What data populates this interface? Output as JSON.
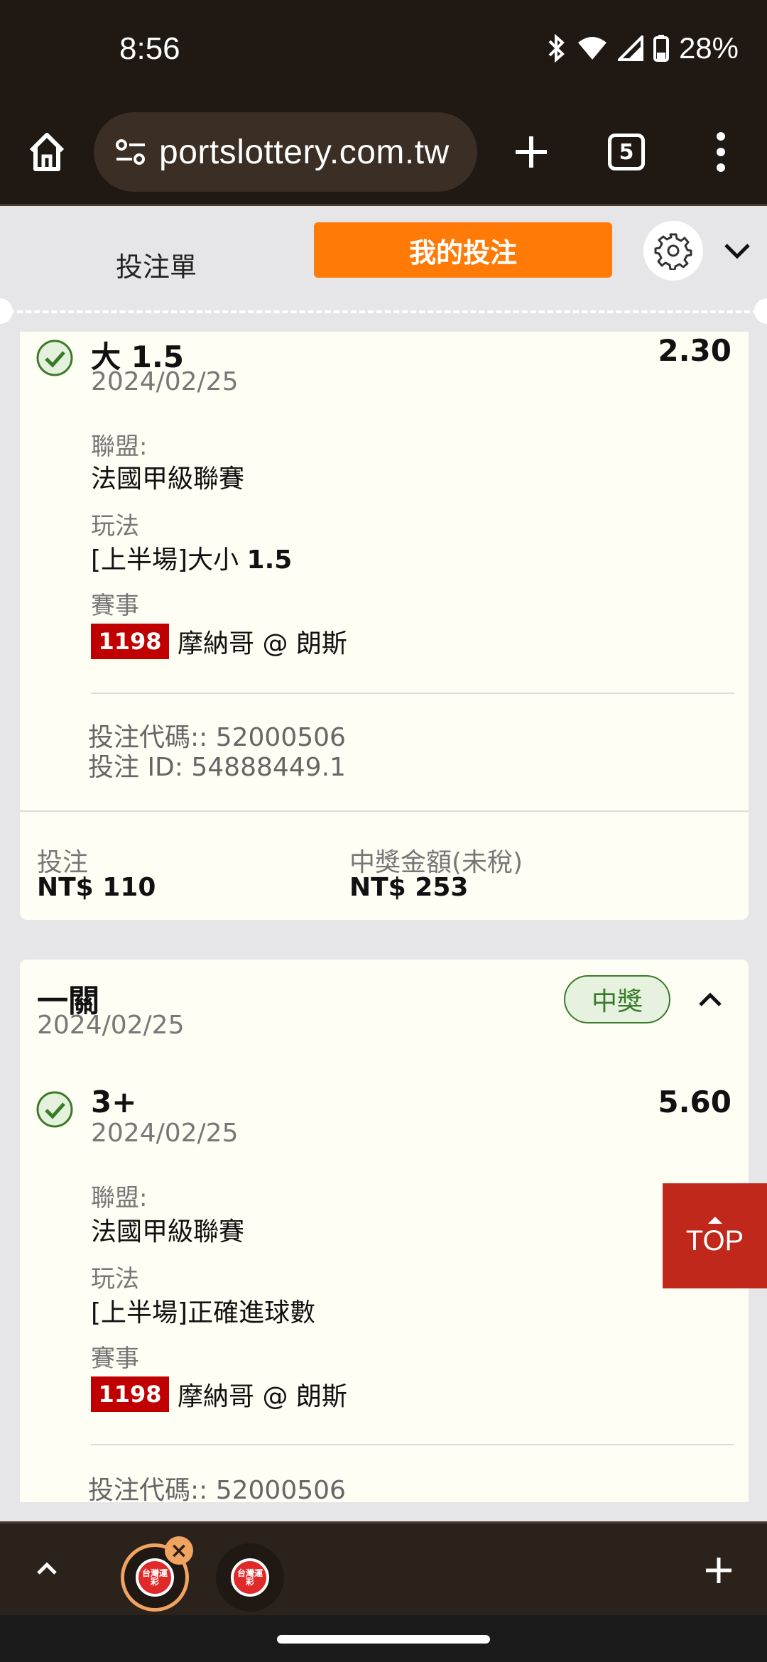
{
  "status_bar": {
    "time": "8:56",
    "battery": "28%",
    "icons": [
      "bluetooth-icon",
      "wifi-icon",
      "signal-icon",
      "battery-icon"
    ]
  },
  "browser": {
    "url": "portslottery.com.tw",
    "tab_count": "5"
  },
  "sheet": {
    "tab_betslip": "投注單",
    "tab_mybets": "我的投注",
    "accent": "#ff7a06"
  },
  "bet1": {
    "selection": "大 1.5",
    "odds": "2.30",
    "date": "2024/02/25",
    "league_label": "聯盟:",
    "league": "法國甲級聯賽",
    "market_label": "玩法",
    "market_prefix": "[上半場]大小 ",
    "market_line": "1.5",
    "event_label": "賽事",
    "event_no": "1198",
    "event": "摩納哥 @ 朗斯",
    "bet_code": "投注代碼:: 52000506",
    "bet_id": "投注 ID: 54888449.1",
    "stake_label": "投注",
    "stake": "NT$ 110",
    "payout_label": "中獎金額(未稅)",
    "payout": "NT$ 253"
  },
  "bet2": {
    "type": "一關",
    "date": "2024/02/25",
    "status": "中獎",
    "selection": "3+",
    "odds": "5.60",
    "sel_date": "2024/02/25",
    "league_label": "聯盟:",
    "league": "法國甲級聯賽",
    "market_label": "玩法",
    "market": "[上半場]正確進球數",
    "event_label": "賽事",
    "event_no": "1198",
    "event": "摩納哥 @ 朗斯",
    "bet_code": "投注代碼:: 52000506"
  },
  "top_button": {
    "label": "TOP"
  },
  "tab_strip": {
    "logo_text": "台灣運彩"
  }
}
